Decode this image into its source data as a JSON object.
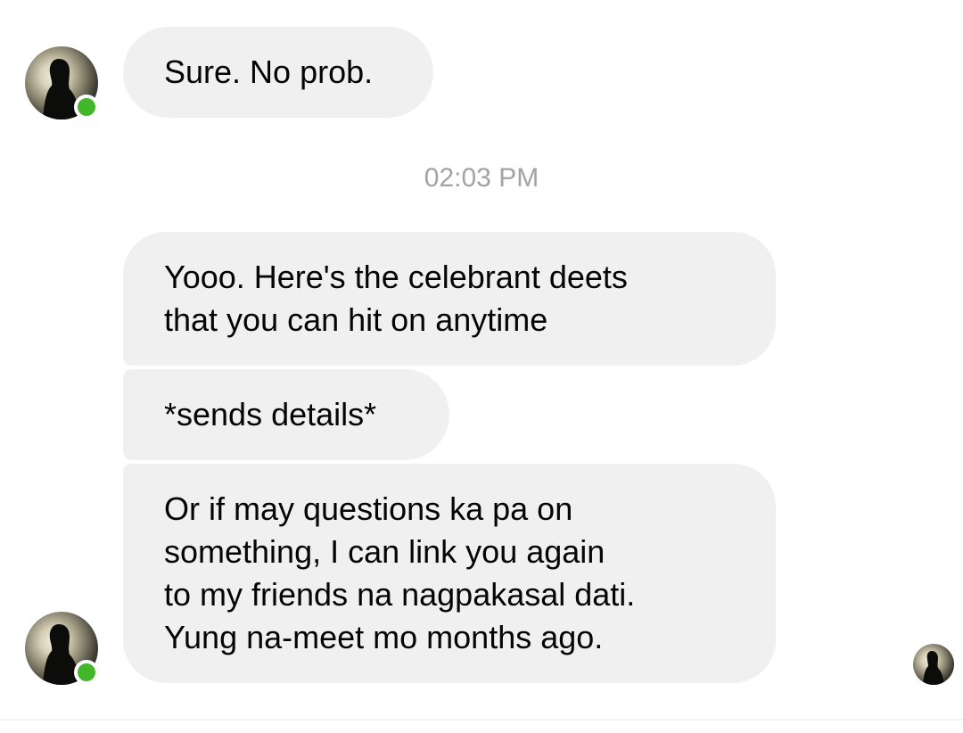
{
  "conversation": {
    "messages": [
      {
        "text": "Sure. No prob."
      },
      {
        "text": "Yooo. Here's the celebrant deets\nthat you can hit on anytime"
      },
      {
        "text": "*sends details*"
      },
      {
        "text": "Or if may questions ka pa on\nsomething, I can link you again\nto my friends na nagpakasal dati.\nYung na-meet mo months ago."
      }
    ],
    "timestamp": "02:03 PM"
  },
  "sender": {
    "status": "online",
    "status_color": "#42b72a"
  },
  "colors": {
    "bubble_bg": "#f0f0f0",
    "text": "#050505",
    "timestamp": "#a3a3a3"
  },
  "icons": {
    "avatar": "silhouette-avatar-icon",
    "online": "online-status-dot-icon",
    "seen": "seen-receipt-avatar-icon"
  }
}
